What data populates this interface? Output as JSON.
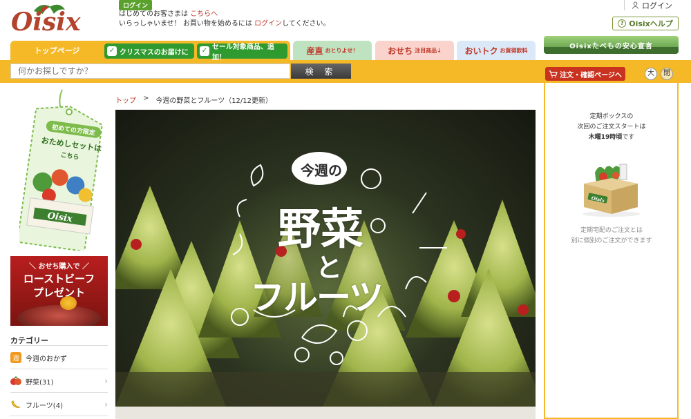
{
  "header": {
    "logo_text": "Oisix",
    "login_badge": "ログイン",
    "line1_text": "はじめてのお客さまは",
    "line1_link": "こちらへ",
    "line2_text_a": "いらっしゃいませ！ お買い物を始めるには",
    "line2_link": "ログイン",
    "line2_text_b": "してください。",
    "login_label": "ログイン",
    "help_label": "Oisixヘルプ"
  },
  "tabs": {
    "top": "トップページ",
    "xmas": "クリスマスのお届けに",
    "sale": "セール対象商品、追加！",
    "sanchoku": "産直",
    "sanchoku_sub": "おとりよせ！",
    "osechi": "おせち",
    "osechi_sub": "注目商品↓",
    "otoku": "おいトク",
    "otoku_sub": "お買得飲料",
    "anshin_banner": "Oisixたべもの安心宣言"
  },
  "search": {
    "placeholder": "何かお探しですか？",
    "button": "検 索"
  },
  "order": {
    "button": "注文・確認ページへ",
    "size_large": "大",
    "size_close": "閉"
  },
  "panel": {
    "line1": "定期ボックスの",
    "line2": "次回のご注文スタートは",
    "line3_bold": "木曜19時頃",
    "line3_rest": "です",
    "box_label": "Oisix",
    "note1": "定期宅配のご注文とは",
    "note2": "別に個別のご注文ができます"
  },
  "trial": {
    "line1": "初めての方限定",
    "line2": "おためしセットは",
    "line3": "こちら",
    "box_label": "Oisix"
  },
  "roast": {
    "line1": "＼ おせち購入で ／",
    "line2": "ローストビーフ",
    "line3": "プレゼント"
  },
  "categories": {
    "title": "カテゴリー",
    "items": [
      {
        "icon": "weekly-badge-icon",
        "label": "今週のおかず",
        "arrow": false
      },
      {
        "icon": "tomato-icon",
        "label": "野菜(31)",
        "arrow": true
      },
      {
        "icon": "banana-icon",
        "label": "フルーツ(4)",
        "arrow": true
      }
    ]
  },
  "breadcrumb": {
    "home": "トップ",
    "separator": ">",
    "current": "今週の野菜とフルーツ（12/12更新）"
  },
  "hero": {
    "title_small": "今週の",
    "title_line1": "野菜",
    "title_line2": "と",
    "title_line3": "フルーツ"
  },
  "colors": {
    "accent_yellow": "#f5b928",
    "green": "#2f9a2f",
    "red": "#c8321f"
  }
}
